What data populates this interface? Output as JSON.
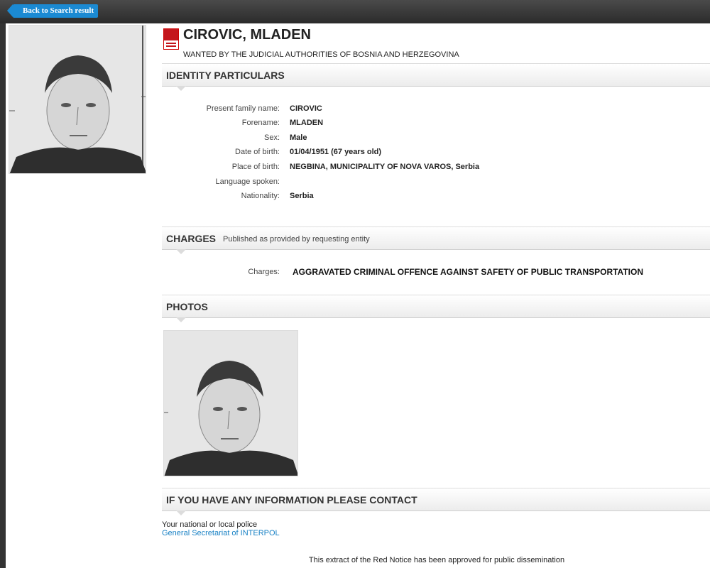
{
  "nav": {
    "back_label": "Back to Search result"
  },
  "person": {
    "name": "CIROVIC, MLADEN",
    "subtitle": "WANTED BY THE JUDICIAL AUTHORITIES OF BOSNIA AND HERZEGOVINA"
  },
  "identity": {
    "title": "IDENTITY PARTICULARS",
    "fields": [
      {
        "label": "Present family name:",
        "value": "CIROVIC"
      },
      {
        "label": "Forename:",
        "value": "MLADEN"
      },
      {
        "label": "Sex:",
        "value": "Male"
      },
      {
        "label": "Date of birth:",
        "value": "01/04/1951 (67 years old)"
      },
      {
        "label": "Place of birth:",
        "value": "NEGBINA, MUNICIPALITY OF NOVA VAROS, Serbia"
      },
      {
        "label": "Language spoken:",
        "value": ""
      },
      {
        "label": "Nationality:",
        "value": "Serbia"
      }
    ]
  },
  "charges": {
    "title": "CHARGES",
    "note": "Published as provided by requesting entity",
    "label": "Charges:",
    "value": "AGGRAVATED CRIMINAL OFFENCE AGAINST SAFETY OF PUBLIC TRANSPORTATION"
  },
  "photos": {
    "title": "PHOTOS"
  },
  "contact": {
    "title": "IF YOU HAVE ANY INFORMATION PLEASE CONTACT",
    "line1": "Your national or local police",
    "line2": "General Secretariat of INTERPOL"
  },
  "footer": {
    "text": "This extract of the Red Notice has been approved for public dissemination"
  },
  "colors": {
    "accent": "#1b8ad3",
    "link": "#1a82c5",
    "notice_red": "#c4161c"
  },
  "icons": {
    "notice": "red-notice-icon"
  }
}
